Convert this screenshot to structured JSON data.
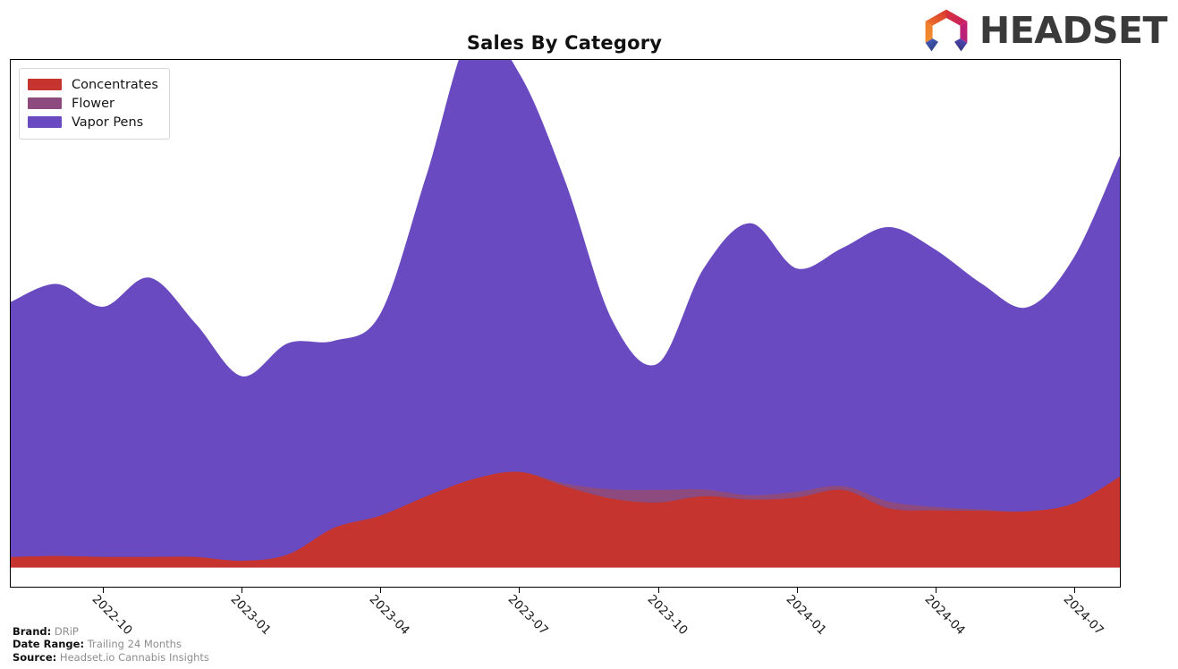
{
  "header": {
    "title": "Sales By Category",
    "logo_word": "HEADSET",
    "logo_icon": "headset-hexagon-logo"
  },
  "footer": {
    "brand_key": "Brand:",
    "brand_value": "DRiP",
    "date_range_key": "Date Range:",
    "date_range_value": "Trailing 24 Months",
    "source_key": "Source:",
    "source_value": "Headset.io Cannabis Insights"
  },
  "legend": {
    "position": "upper-left",
    "items": [
      {
        "label": "Concentrates",
        "color": "#c5342e"
      },
      {
        "label": "Flower",
        "color": "#8c4a7e"
      },
      {
        "label": "Vapor Pens",
        "color": "#6a4ac0"
      }
    ]
  },
  "chart_data": {
    "type": "area",
    "stacked": true,
    "title": "Sales By Category",
    "xlabel": "",
    "ylabel": "",
    "grid": false,
    "legend_position": "upper left",
    "x": [
      "2022-08",
      "2022-09",
      "2022-10",
      "2022-11",
      "2022-12",
      "2023-01",
      "2023-02",
      "2023-03",
      "2023-04",
      "2023-05",
      "2023-06",
      "2023-07",
      "2023-08",
      "2023-09",
      "2023-10",
      "2023-11",
      "2023-12",
      "2024-01",
      "2024-02",
      "2024-03",
      "2024-04",
      "2024-05",
      "2024-06",
      "2024-07",
      "2024-08"
    ],
    "xtick_labels": [
      "2022-10",
      "2023-01",
      "2023-04",
      "2023-07",
      "2023-10",
      "2024-01",
      "2024-04",
      "2024-07"
    ],
    "xtick_rotation": 45,
    "ytick_labels": [],
    "ylim": [
      0,
      100
    ],
    "series": [
      {
        "name": "Concentrates",
        "color": "#c5342e",
        "values": [
          2.0,
          2.2,
          2.0,
          2.0,
          2.0,
          1.2,
          2.5,
          8.0,
          10.5,
          14.5,
          18.0,
          19.5,
          16.5,
          14.0,
          13.2,
          14.5,
          13.8,
          14.2,
          15.8,
          12.0,
          11.6,
          11.5,
          11.4,
          13.0,
          18.5
        ]
      },
      {
        "name": "Flower",
        "color": "#8c4a7e",
        "values": [
          0.0,
          0.0,
          0.0,
          0.0,
          0.0,
          0.0,
          0.0,
          0.0,
          0.0,
          0.0,
          0.0,
          0.0,
          0.6,
          1.9,
          2.6,
          1.4,
          0.9,
          1.2,
          0.8,
          1.4,
          0.7,
          0.3,
          0.0,
          0.0,
          0.0
        ]
      },
      {
        "name": "Vapor Pens",
        "color": "#6a4ac0",
        "values": [
          52.5,
          56.0,
          51.5,
          57.5,
          48.0,
          38.0,
          43.5,
          38.5,
          41.5,
          66.0,
          92.5,
          82.0,
          62.0,
          35.0,
          26.0,
          45.5,
          56.0,
          46.0,
          49.0,
          56.5,
          53.0,
          46.5,
          42.0,
          50.5,
          66.0
        ]
      }
    ]
  }
}
